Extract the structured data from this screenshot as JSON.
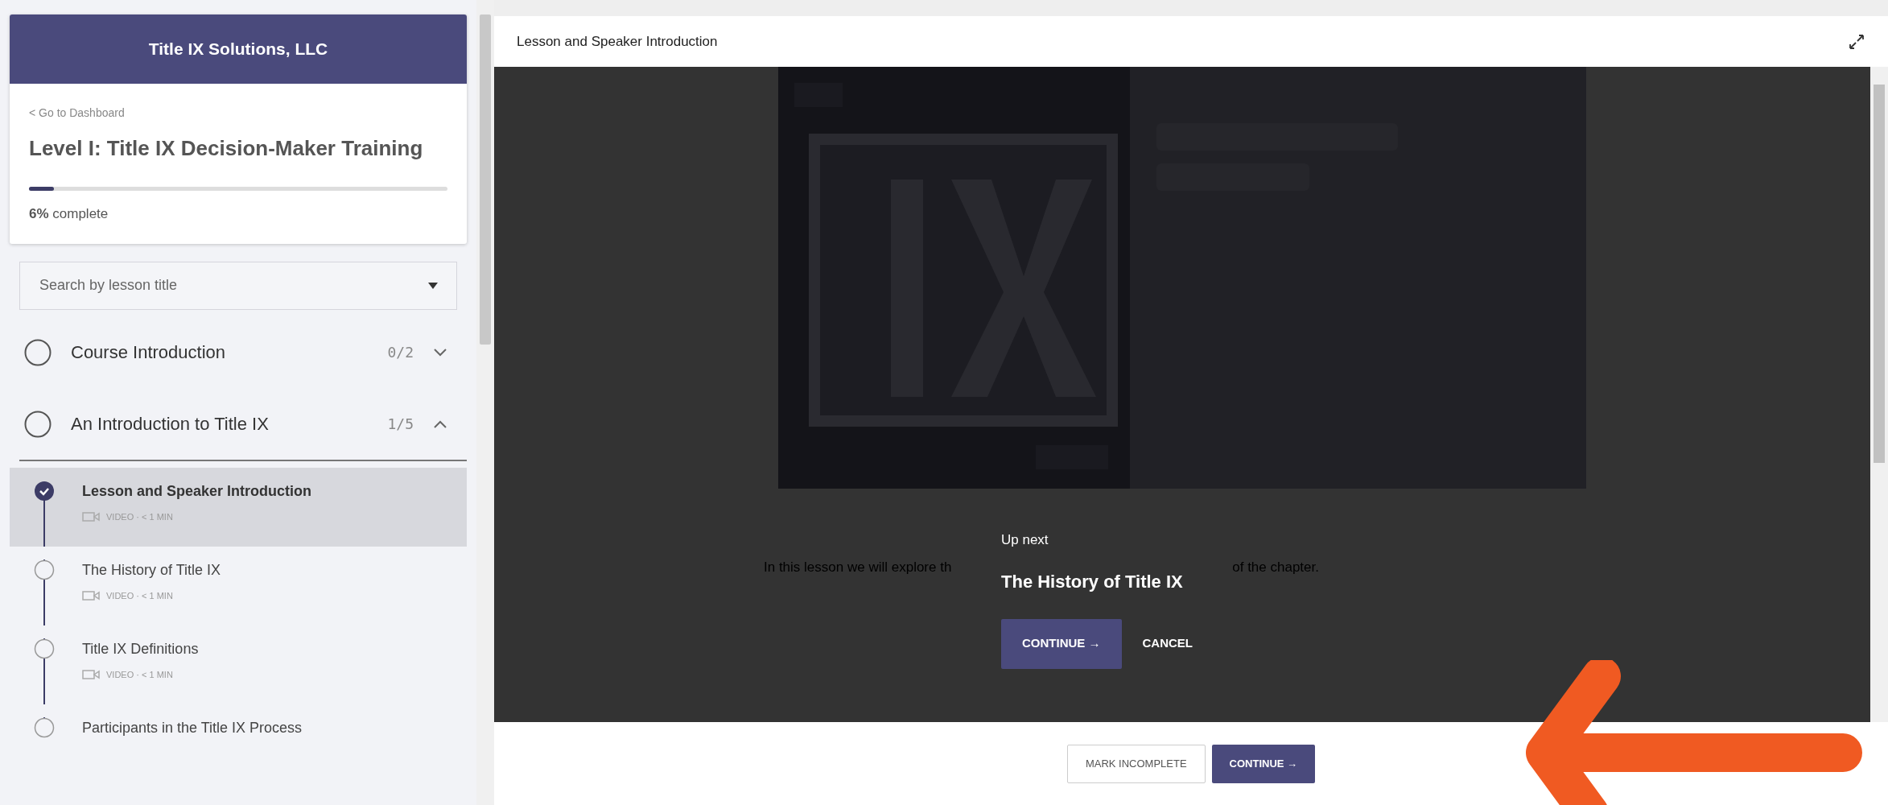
{
  "sidebar": {
    "brand": "Title IX Solutions, LLC",
    "back_link": "< Go to Dashboard",
    "course_title": "Level I: Title IX Decision-Maker Training",
    "progress": {
      "level": 0.06,
      "label": "**6%** complete"
    },
    "search": {
      "placeholder": "Search by lesson title"
    },
    "sections": [
      {
        "title": "Course Introduction",
        "count": "0/2",
        "expanded": false,
        "completed": false
      },
      {
        "title": "An Introduction to Title IX",
        "count": "1/5",
        "expanded": true,
        "completed": false,
        "lessons": [
          {
            "title": "Lesson and Speaker Introduction",
            "meta": "VIDEO · < 1 MIN",
            "completed": true,
            "selected": true
          },
          {
            "title": "The History of Title IX",
            "meta": "VIDEO · < 1 MIN",
            "completed": false,
            "selected": false
          },
          {
            "title": "Title IX Definitions",
            "meta": "VIDEO · < 1 MIN",
            "completed": false,
            "selected": false
          },
          {
            "title": "Participants in the Title IX Process",
            "completed": false,
            "selected": false
          }
        ]
      }
    ]
  },
  "main": {
    "lesson_title": "Lesson and Speaker Introduction",
    "description": [
      "In this lesson we will explore th",
      "of the chapter."
    ],
    "up_next": {
      "label": "Up next",
      "title": "The History of Title IX",
      "continue": "CONTINUE →",
      "cancel": "CANCEL"
    },
    "footer": {
      "mark_incomplete": "MARK INCOMPLETE",
      "continue": "CONTINUE →"
    }
  }
}
